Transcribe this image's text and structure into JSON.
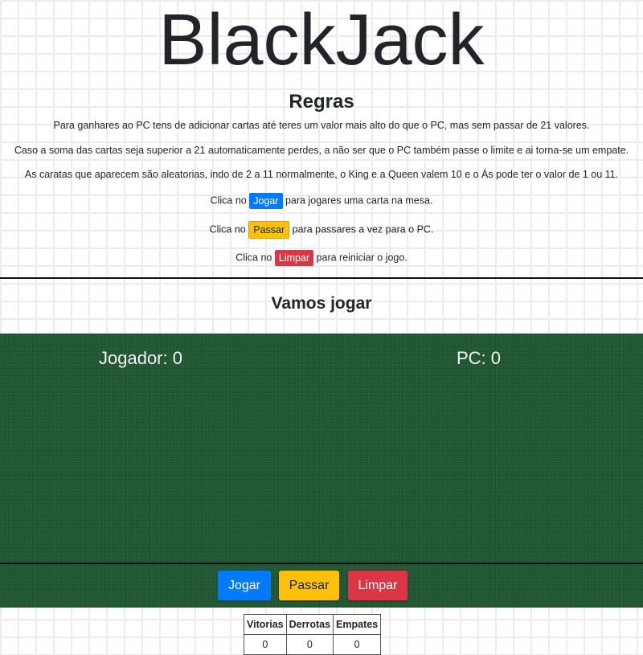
{
  "header": {
    "title": "BlackJack"
  },
  "rules": {
    "heading": "Regras",
    "line1": "Para ganhares ao PC tens de adicionar cartas até teres um valor mais alto do que o PC, mas sem passar de 21 valores.",
    "line2": "Caso a soma das cartas seja superior a 21 automaticamente perdes, a não ser que o PC também passe o limite e ai torna-se um empate.",
    "line3": "As caratas que aparecem são aleatorias, indo de 2 a 11 normalmente, o King e a Queen valem 10 e o Ás pode ter o valor de 1 ou 11.",
    "play_prefix": "Clica no",
    "play_btn": "Jogar",
    "play_suffix": "para jogares uma carta na mesa.",
    "pass_prefix": "Clica no",
    "pass_btn": "Passar",
    "pass_suffix": "para passares a vez para o PC.",
    "clear_prefix": "Clica no",
    "clear_btn": "Limpar",
    "clear_suffix": "para reiniciar o jogo."
  },
  "game": {
    "heading": "Vamos jogar",
    "player_score": "Jogador: 0",
    "pc_score": "PC: 0"
  },
  "controls": {
    "play": "Jogar",
    "pass": "Passar",
    "clear": "Limpar"
  },
  "stats": {
    "headers": [
      "Vitorias",
      "Derrotas",
      "Empates"
    ],
    "values": [
      "0",
      "0",
      "0"
    ]
  },
  "colors": {
    "felt": "#245c36",
    "play": "#007bff",
    "pass": "#ffc107",
    "clear": "#dc3545"
  }
}
